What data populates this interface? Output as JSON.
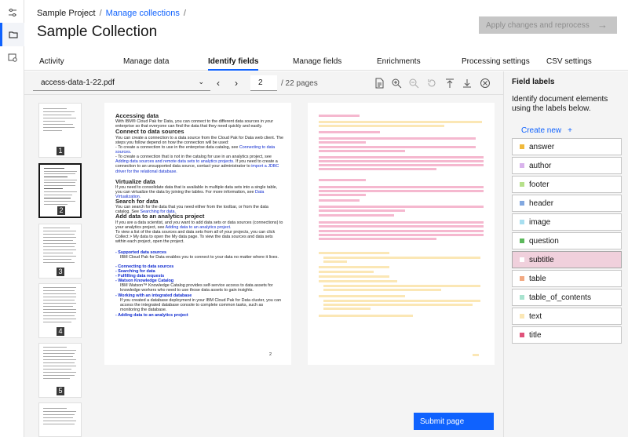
{
  "breadcrumb": {
    "project": "Sample Project",
    "link": "Manage collections",
    "sep": "/"
  },
  "page_title": "Sample Collection",
  "apply_button": {
    "label": "Apply changes and reprocess"
  },
  "tabs": [
    "Activity",
    "Manage data",
    "Identify fields",
    "Manage fields",
    "Enrichments",
    "Processing settings",
    "CSV settings"
  ],
  "active_tab": "Identify fields",
  "viewer": {
    "document_name": "access-data-1-22.pdf",
    "page_number": "2",
    "page_total": "/ 22 pages",
    "thumbnails": [
      "1",
      "2",
      "3",
      "4",
      "5"
    ],
    "selected_thumbnail": "2",
    "submit_label": "Submit page"
  },
  "document_text": {
    "h1": "Accessing data",
    "p1": "With IBM® Cloud Pak for Data, you can connect to the different data sources in your enterprise so that everyone can find the data that they need quickly and easily.",
    "h2": "Connect to data sources",
    "p2": "You can create a connection to a data source from the Cloud Pak for Data web client.  The steps you follow depend on how the connection will be used:",
    "p3": "- To create a connection to use in the enterprise data catalog, see",
    "p3_link": "Connecting to data sources.",
    "p4": "- To create a connection that is not in the catalog for use in an analytics project, see",
    "p4_link": "Adding data sources and remote data sets to analytics projects.",
    "p4_rest": " If you need to create a connection to an unsupported data source, contact your administrator to",
    "p4_link2": "import a JDBC driver for the relational database.",
    "h3": "Virtualize data",
    "p5": "If you need to consolidate data that is available in multiple data sets into a single table, you can virtualize the data by joining the tables. For more information, see",
    "p5_link": "Data Virtualization.",
    "h4": "Search for data",
    "p6": "You can search for the data that you need either from the toolbar, or from the data catalog. See",
    "p6_link": "Searching for data.",
    "h5": "Add data to an analytics project",
    "p7": "If you are a data scientist, and you want to add data sets or data sources (connections) to your analytics project, see",
    "p7_link": "Adding data to an analytics project.",
    "p8": "To view a list of the data sources and data sets from all of your projects, you can click Collect > My data to open the My data page.  To view the data sources and data sets within each project, open the project.",
    "l1": "- Supported data sources",
    "l1b": "IBM Cloud Pak for Data enables you to connect to your data no matter where it lives.",
    "l2": "- Connecting to data sources",
    "l3": "- Searching for data",
    "l4": "- Fulfilling data requests",
    "l5": "- Watson Knowledge Catalog",
    "l5b": "IBM Watson™ Knowledge Catalog provides self-service access to data assets for knowledge workers who need to use those data assets to gain insights.",
    "l6": "- Working with an integrated database",
    "l6b": "If you created a database deployment in your IBM Cloud Pak for Data cluster, you can access the integrated database console to complete common tasks, such as monitoring the database.",
    "l7": "- Adding data to an analytics project",
    "page_no": "2"
  },
  "panel": {
    "title": "Field labels",
    "description": "Identify document elements using the labels below.",
    "create_new": "Create new",
    "create_plus": "+",
    "labels": [
      {
        "name": "answer",
        "color": "#f0b93c"
      },
      {
        "name": "author",
        "color": "#d9b3ec"
      },
      {
        "name": "footer",
        "color": "#b6e08a"
      },
      {
        "name": "header",
        "color": "#82a8e0"
      },
      {
        "name": "image",
        "color": "#a8dff0"
      },
      {
        "name": "question",
        "color": "#5cb85c"
      },
      {
        "name": "subtitle",
        "color": "#ffffff"
      },
      {
        "name": "table",
        "color": "#f2a982"
      },
      {
        "name": "table_of_contents",
        "color": "#a8e3cf"
      },
      {
        "name": "text",
        "color": "#fbe7b5"
      },
      {
        "name": "title",
        "color": "#e0527a"
      }
    ],
    "selected_label": "subtitle"
  },
  "colors": {
    "accent": "#0f62fe",
    "subtitle_highlight": "#f0d0dc",
    "text_highlight": "#fbe7b5",
    "selected_highlight": "#f5b8cf"
  }
}
